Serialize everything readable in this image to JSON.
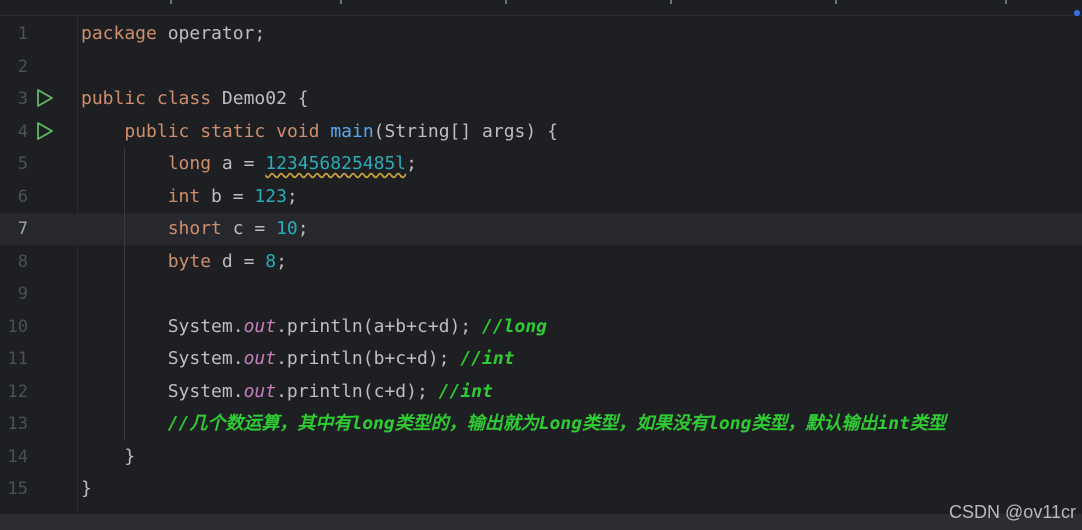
{
  "editor": {
    "current_line": 7,
    "lines": [
      {
        "n": "1",
        "tokens": [
          {
            "t": "kw",
            "v": "package"
          },
          {
            "t": "plain",
            "v": " operator;"
          }
        ]
      },
      {
        "n": "2",
        "tokens": []
      },
      {
        "n": "3",
        "run": true,
        "tokens": [
          {
            "t": "kw",
            "v": "public"
          },
          {
            "t": "plain",
            "v": " "
          },
          {
            "t": "kw",
            "v": "class"
          },
          {
            "t": "plain",
            "v": " Demo02 {"
          }
        ]
      },
      {
        "n": "4",
        "run": true,
        "tokens": [
          {
            "t": "plain",
            "v": "    "
          },
          {
            "t": "kw",
            "v": "public"
          },
          {
            "t": "plain",
            "v": " "
          },
          {
            "t": "kw",
            "v": "static"
          },
          {
            "t": "plain",
            "v": " "
          },
          {
            "t": "kw",
            "v": "void"
          },
          {
            "t": "plain",
            "v": " "
          },
          {
            "t": "fn",
            "v": "main"
          },
          {
            "t": "plain",
            "v": "(String[] args) {"
          }
        ]
      },
      {
        "n": "5",
        "tokens": [
          {
            "t": "plain",
            "v": "        "
          },
          {
            "t": "kw",
            "v": "long"
          },
          {
            "t": "plain",
            "v": " a = "
          },
          {
            "t": "num warn",
            "v": "123456825485l"
          },
          {
            "t": "plain",
            "v": ";"
          }
        ]
      },
      {
        "n": "6",
        "tokens": [
          {
            "t": "plain",
            "v": "        "
          },
          {
            "t": "kw",
            "v": "int"
          },
          {
            "t": "plain",
            "v": " b = "
          },
          {
            "t": "num",
            "v": "123"
          },
          {
            "t": "plain",
            "v": ";"
          }
        ]
      },
      {
        "n": "7",
        "tokens": [
          {
            "t": "plain",
            "v": "        "
          },
          {
            "t": "kw",
            "v": "short"
          },
          {
            "t": "plain",
            "v": " c = "
          },
          {
            "t": "num",
            "v": "10"
          },
          {
            "t": "plain",
            "v": ";"
          }
        ]
      },
      {
        "n": "8",
        "tokens": [
          {
            "t": "plain",
            "v": "        "
          },
          {
            "t": "kw",
            "v": "byte"
          },
          {
            "t": "plain",
            "v": " d = "
          },
          {
            "t": "num",
            "v": "8"
          },
          {
            "t": "plain",
            "v": ";"
          }
        ]
      },
      {
        "n": "9",
        "tokens": []
      },
      {
        "n": "10",
        "tokens": [
          {
            "t": "plain",
            "v": "        System."
          },
          {
            "t": "field",
            "v": "out"
          },
          {
            "t": "plain",
            "v": ".println(a+b+c+d); "
          },
          {
            "t": "cmt",
            "v": "//long"
          }
        ]
      },
      {
        "n": "11",
        "tokens": [
          {
            "t": "plain",
            "v": "        System."
          },
          {
            "t": "field",
            "v": "out"
          },
          {
            "t": "plain",
            "v": ".println(b+c+d); "
          },
          {
            "t": "cmt",
            "v": "//int"
          }
        ]
      },
      {
        "n": "12",
        "tokens": [
          {
            "t": "plain",
            "v": "        System."
          },
          {
            "t": "field",
            "v": "out"
          },
          {
            "t": "plain",
            "v": ".println(c+d); "
          },
          {
            "t": "cmt",
            "v": "//int"
          }
        ]
      },
      {
        "n": "13",
        "tokens": [
          {
            "t": "plain",
            "v": "        "
          },
          {
            "t": "cmt",
            "v": "//几个数运算，其中有long类型的，输出就为Long类型，如果没有long类型，默认输出int类型"
          }
        ]
      },
      {
        "n": "14",
        "tokens": [
          {
            "t": "plain",
            "v": "    }"
          }
        ]
      },
      {
        "n": "15",
        "tokens": [
          {
            "t": "plain",
            "v": "}"
          }
        ]
      }
    ]
  },
  "watermark": "CSDN @ov11cr",
  "colors": {
    "background": "#1e1f22",
    "keyword": "#cf8e6d",
    "number": "#2aacb8",
    "method": "#56a8f5",
    "field": "#c77dbb",
    "comment": "#2ecb33",
    "run_icon": "#5fb865"
  },
  "icons": {
    "run": "run-triangle-icon"
  }
}
